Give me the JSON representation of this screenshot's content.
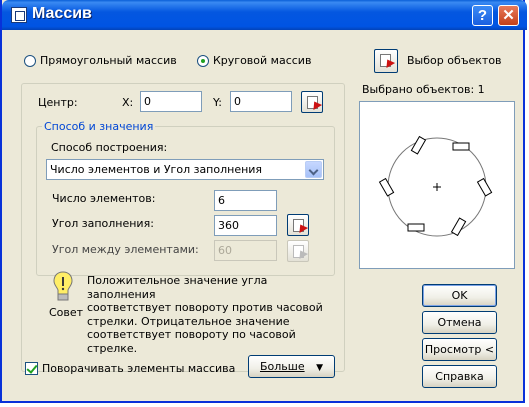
{
  "window": {
    "title": "Массив",
    "help_btn": "?",
    "close_btn": "✕"
  },
  "array_type": {
    "rect_label": "Прямоугольный массив",
    "polar_label": "Круговой массив",
    "selected": "polar"
  },
  "select_objects": {
    "label": "Выбор объектов",
    "selected_count": "Выбрано объектов: 1"
  },
  "center": {
    "label": "Центр:",
    "x_label": "X:",
    "x_value": "0",
    "y_label": "Y:",
    "y_value": "0"
  },
  "method_group": {
    "title": "Способ и значения",
    "method_label": "Способ построения:",
    "method_value": "Число элементов и Угол заполнения",
    "count_label": "Число элементов:",
    "count_value": "6",
    "fill_angle_label": "Угол заполнения:",
    "fill_angle_value": "360",
    "between_angle_label": "Угол между элементами:",
    "between_angle_value": "60"
  },
  "tip": {
    "caption": "Совет",
    "lines": [
      "Положительное значение угла заполнения",
      "соответствует повороту против часовой",
      "стрелки. Отрицательное значение",
      "соответствует повороту по часовой стрелке."
    ]
  },
  "rotate_items": {
    "label": "Поворачивать элементы массива",
    "checked": true
  },
  "buttons": {
    "more": "Больше",
    "ok": "OK",
    "cancel": "Отмена",
    "preview": "Просмотр <",
    "help": "Справка"
  },
  "colors": {
    "titlebar": "#0054e3",
    "dialog_bg": "#ece9d8",
    "group_title": "#0046d5"
  }
}
